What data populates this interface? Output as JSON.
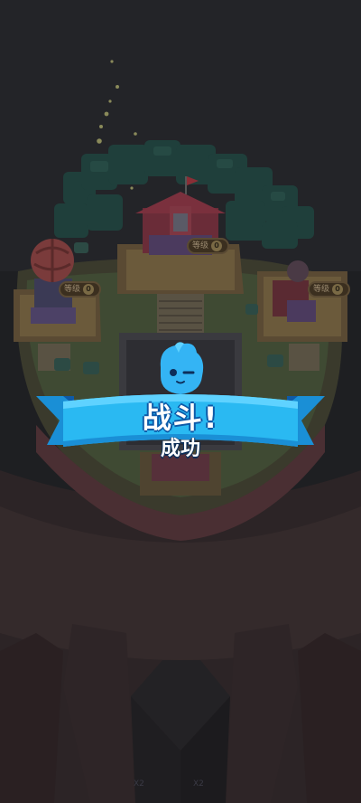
{
  "colors": {
    "banner_blue": "#2ab9f2",
    "banner_dark": "#0d5aa8",
    "mascot_blue": "#34b4f4",
    "background": "#1c1b1e"
  },
  "icons": {
    "mascot": "blue-mascot-icon",
    "flag": "flag-icon"
  },
  "result": {
    "title": "战斗!",
    "subtitle": "成功"
  },
  "buildings": [
    {
      "name": "town-hall",
      "level_label": "等级",
      "level_value": "0"
    },
    {
      "name": "left-tower",
      "level_label": "等级",
      "level_value": "0"
    },
    {
      "name": "right-factory",
      "level_label": "等级",
      "level_value": "0"
    }
  ],
  "markers": [
    "X2",
    "X2"
  ]
}
